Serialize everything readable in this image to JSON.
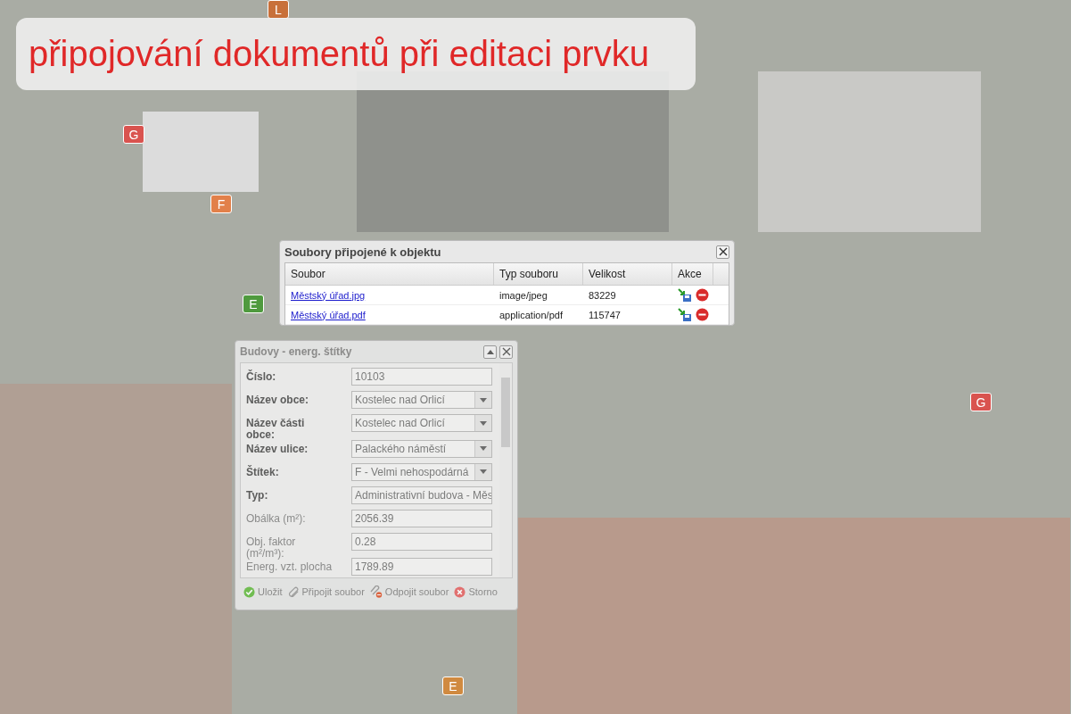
{
  "banner": {
    "title": "připojování dokumentů při editaci prvku"
  },
  "markers": [
    {
      "label": "L",
      "color": "#c8703a"
    },
    {
      "label": "G",
      "color": "#d9534f"
    },
    {
      "label": "F",
      "color": "#e2804a"
    },
    {
      "label": "E",
      "color": "#4f9a3e"
    },
    {
      "label": "G",
      "color": "#d9534f"
    },
    {
      "label": "E",
      "color": "#d08a40"
    }
  ],
  "files_dialog": {
    "title": "Soubory připojené k objektu",
    "columns": [
      "Soubor",
      "Typ souboru",
      "Velikost",
      "Akce"
    ],
    "rows": [
      {
        "name": "Městský úřad.jpg",
        "type": "image/jpeg",
        "size": "83229"
      },
      {
        "name": "Městský úřad.pdf",
        "type": "application/pdf",
        "size": "115747"
      }
    ]
  },
  "form_panel": {
    "title": "Budovy - energ. štítky",
    "fields": [
      {
        "label": "Číslo:",
        "value": "10103",
        "kind": "text",
        "required": true
      },
      {
        "label": "Název obce:",
        "value": "Kostelec nad Orlicí",
        "kind": "select",
        "required": true
      },
      {
        "label": "Název části obce:",
        "value": "Kostelec nad Orlicí",
        "kind": "select",
        "required": true
      },
      {
        "label": "Název ulice:",
        "value": "Palackého náměstí",
        "kind": "select",
        "required": true
      },
      {
        "label": "Štítek:",
        "value": "F - Velmi nehospodárná",
        "kind": "select",
        "required": true
      },
      {
        "label": "Typ:",
        "value": "Administrativní budova - Měs",
        "kind": "text",
        "required": true
      },
      {
        "label": "Obálka (m²):",
        "value": "2056.39",
        "kind": "text",
        "required": false
      },
      {
        "label": "Obj. faktor (m²/m³):",
        "value": "0.28",
        "kind": "text",
        "required": false
      },
      {
        "label": "Energ. vzt. plocha",
        "value": "1789.89",
        "kind": "text",
        "required": false
      }
    ],
    "buttons": [
      {
        "label": "Uložit",
        "kind": "save"
      },
      {
        "label": "Připojit soubor",
        "kind": "attach"
      },
      {
        "label": "Odpojit soubor",
        "kind": "detach"
      },
      {
        "label": "Storno",
        "kind": "cancel"
      }
    ]
  }
}
